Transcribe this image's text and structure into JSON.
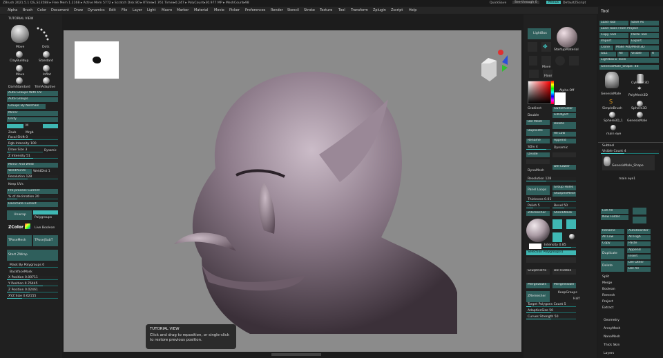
{
  "status": {
    "info": "ZBrush 2021.5.1  QS_S13588  ▸ Free Mem 1.2168 ▸ Active Mem 5772 ▸ Scratch Disk 80 ▸ RTime▸5.761 Timer▸0.247 ▸ PolyCount▸30.977 MP ▸ MeshCount▸98",
    "quicksave": "QuickSave",
    "seethrough": "See-through 0",
    "menus": "Menus",
    "default_script": "DefaultZScript"
  },
  "menu": [
    "Alpha",
    "Brush",
    "Color",
    "Document",
    "Draw",
    "Dynamics",
    "Edit",
    "File",
    "Layer",
    "Light",
    "Macro",
    "Marker",
    "Material",
    "Movie",
    "Picker",
    "Preferences",
    "Render",
    "Stencil",
    "Stroke",
    "Texture",
    "Tool",
    "Transform",
    "Zplugin",
    "Zscript",
    "Help"
  ],
  "left": {
    "tutorial_view": "TUTORIAL VIEW",
    "brushes": [
      "Move",
      "Dots",
      "ClayBuildup",
      "Standard",
      "Move",
      "Inflat",
      "DamStandard",
      "TrimAdaptive"
    ],
    "buttons": [
      "Auto Groups With UV",
      "Auto Groups",
      "Groups By Normals"
    ],
    "mirror": "Mirror",
    "unify": "Unify",
    "m": "M",
    "zsub": "Zsub",
    "mrgb": "Mrgb",
    "focal_shift": "Focal Shift 0",
    "rgb_intensity": "Rgb Intensity 100",
    "dynamic": "Dynamic",
    "draw_size": "Draw Size 3",
    "z_intensity": "Z Intensity 51",
    "mirror_weld": "Mirror And Weld",
    "weld_points": "WeldPoints",
    "welddist": "WeldDist 1",
    "resolution": "Resolution 128",
    "keep_uvs": "Keep UVs",
    "k_reduction": "Pre-process Current",
    "pct_decimation": "% of decimation 20",
    "decimate": "Decimate Current",
    "unwrap": "Unwrap",
    "polygroups": "Polygroups",
    "zcolor": "ZColor",
    "live_boolean": "Live Boolean",
    "tpose_mesh": "TPoseMesh",
    "tpose_subt": "TPose|SubT",
    "start_zwrap": "Start ZWrap",
    "mask_by_polygroups": "Mask By Polygroups 0",
    "backface_mask": "BackfaceMask",
    "x_position": "X Position 0.00711",
    "y_position": "Y Position 0.76445",
    "z_position": "Z Position 0.02461",
    "xyz_size": "XYZ Size 0.62155"
  },
  "canvas": {
    "tooltip_title": "TUTORIAL VIEW",
    "tooltip_text": "Click and drag to reposition, or single-click to restore previous position."
  },
  "shelf": {
    "lightbox": "LightBox",
    "startup_material": "StartupMaterial",
    "move": "Move",
    "floor": "Floor",
    "alpha_off": "Alpha Off",
    "gradient": "Gradient",
    "switch_color": "SwitchColor",
    "double": "Double",
    "fill_object": "FillObject",
    "del_mesh": "Del Mesh",
    "delete": "Delete",
    "duplicate": "Duplicate",
    "all_low": "All Low",
    "rename": "Rename",
    "append": "Append",
    "sdiv": "SDiv 4",
    "dynamic": "Dynamic",
    "divide": "Divide",
    "del_lower": "Del Lower",
    "dynamesh": "DynaMesh",
    "resolution": "Resolution 128",
    "panel_loops": "Panel Loops",
    "group_holes": "Group Holes",
    "sharpen_mesh": "SharpenMesh",
    "thickness": "Thickness 0.01",
    "polish": "Polish 5",
    "bevel": "Bevel 50",
    "zremesher": "ZRemesher",
    "shrink_mask": "ShrinkMask",
    "intensity": "Intensity 0.85",
    "polygroups_type": "Selection Polygroup(s)",
    "merge_down": "MergeDown",
    "merge_visible": "MergeVisible",
    "keep_groups": "KeepGroups",
    "half": "Half",
    "zremesher2": "ZRemesher",
    "target_count": "Target Polygons Count 5",
    "adaptive_size": "AdaptiveSize 50",
    "curves_strength": "Curves Strength 50",
    "split_hidden": "Del Hidden",
    "sculptrispro": "SculptrisPro"
  },
  "tool": {
    "title": "Tool",
    "buttons": [
      "Load Tool",
      "Save As",
      "Load Tools From Project",
      "Copy Tool",
      "Paste Tool",
      "Import",
      "Export",
      "Clone",
      "Make PolyMesh3D",
      "GoZ",
      "All",
      "Visible",
      "R",
      "Lightbox ▸ Tools"
    ],
    "current": "GenesisMale_Shape. 46",
    "items": [
      "GenesisMale",
      "Cylinder3D",
      "PolyMesh3D",
      "SimpleBrush",
      "Sphere3D",
      "Sphere3D_1",
      "GenesisMale",
      "main eye"
    ],
    "subtool": "Subtool",
    "visible_count": "Visible Count 4",
    "sub_items": [
      "GenesisMale_Shape",
      "main eye1"
    ],
    "list_all": "List All",
    "new_folder": "New Folder",
    "rename": "Rename",
    "auto_reorder": "AutoReorder",
    "all_low": "All Low",
    "all_high": "All High",
    "copy": "Copy",
    "paste": "Paste",
    "duplicate": "Duplicate",
    "append": "Append",
    "insert": "Insert",
    "delete": "Delete",
    "del_other": "Del Other",
    "del_all": "Del All",
    "sections": [
      "Split",
      "Merge",
      "Boolean",
      "Remesh",
      "Project",
      "Extract"
    ],
    "panels": [
      "Geometry",
      "ArrayMesh",
      "NanoMesh",
      "Thick Skin",
      "Layers"
    ]
  }
}
